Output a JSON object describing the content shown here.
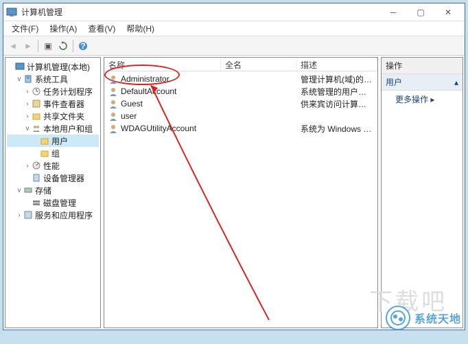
{
  "window": {
    "title": "计算机管理"
  },
  "menu": {
    "file": "文件(F)",
    "action": "操作(A)",
    "view": "查看(V)",
    "help": "帮助(H)"
  },
  "tree": {
    "root": "计算机管理(本地)",
    "system_tools": "系统工具",
    "task_scheduler": "任务计划程序",
    "event_viewer": "事件查看器",
    "shared_folders": "共享文件夹",
    "local_users_groups": "本地用户和组",
    "users": "用户",
    "groups": "组",
    "performance": "性能",
    "device_manager": "设备管理器",
    "storage": "存储",
    "disk_management": "磁盘管理",
    "services_apps": "服务和应用程序"
  },
  "columns": {
    "name": "名称",
    "fullname": "全名",
    "description": "描述"
  },
  "users": [
    {
      "name": "Administrator",
      "fullname": "",
      "desc": "管理计算机(域)的内置帐户"
    },
    {
      "name": "DefaultAccount",
      "fullname": "",
      "desc": "系统管理的用户帐户。"
    },
    {
      "name": "Guest",
      "fullname": "",
      "desc": "供来宾访问计算机或访问域的内..."
    },
    {
      "name": "user",
      "fullname": "",
      "desc": ""
    },
    {
      "name": "WDAGUtilityAccount",
      "fullname": "",
      "desc": "系统为 Windows Defender 应用..."
    }
  ],
  "actions": {
    "header": "操作",
    "group": "用户",
    "more": "更多操作"
  },
  "watermark": {
    "text": "系统天地",
    "faded": "下载吧"
  }
}
